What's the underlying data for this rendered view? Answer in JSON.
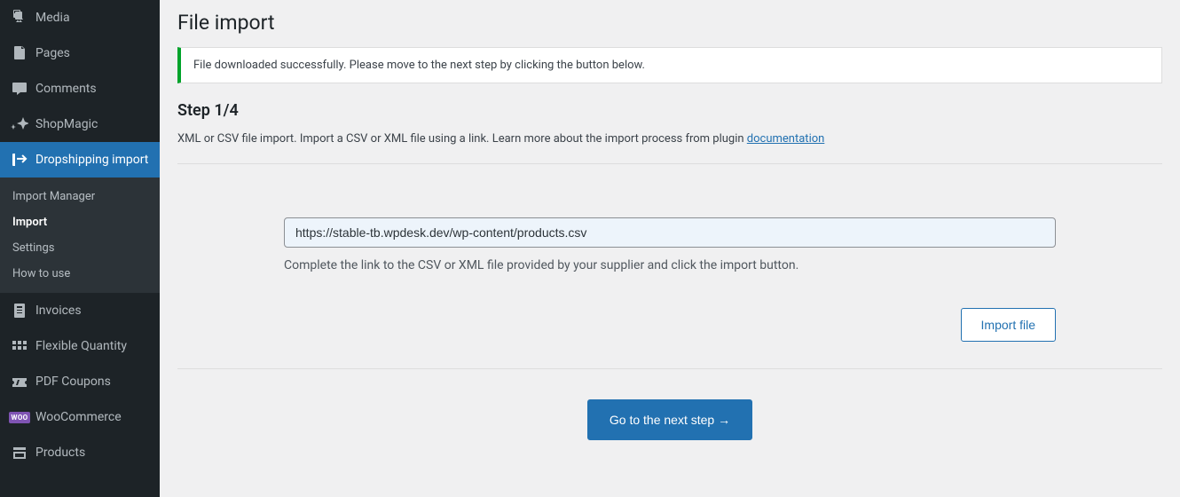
{
  "sidebar": {
    "items": [
      {
        "label": "Media"
      },
      {
        "label": "Pages"
      },
      {
        "label": "Comments"
      },
      {
        "label": "ShopMagic"
      },
      {
        "label": "Dropshipping import"
      }
    ],
    "items2": [
      {
        "label": "Invoices"
      },
      {
        "label": "Flexible Quantity"
      },
      {
        "label": "PDF Coupons"
      },
      {
        "label": "WooCommerce"
      },
      {
        "label": "Products"
      }
    ],
    "submenu": [
      {
        "label": "Import Manager"
      },
      {
        "label": "Import"
      },
      {
        "label": "Settings"
      },
      {
        "label": "How to use"
      }
    ]
  },
  "page": {
    "title": "File import",
    "notice": "File downloaded successfully. Please move to the next step by clicking the button below.",
    "step_heading": "Step 1/4",
    "description_prefix": "XML or CSV file import. Import a CSV or XML file using a link. Learn more about the import process from plugin ",
    "documentation_link": "documentation",
    "url_value": "https://stable-tb.wpdesk.dev/wp-content/products.csv",
    "hint": "Complete the link to the CSV or XML file provided by your supplier and click the import button.",
    "import_button": "Import file",
    "next_button": "Go to the next step →"
  }
}
